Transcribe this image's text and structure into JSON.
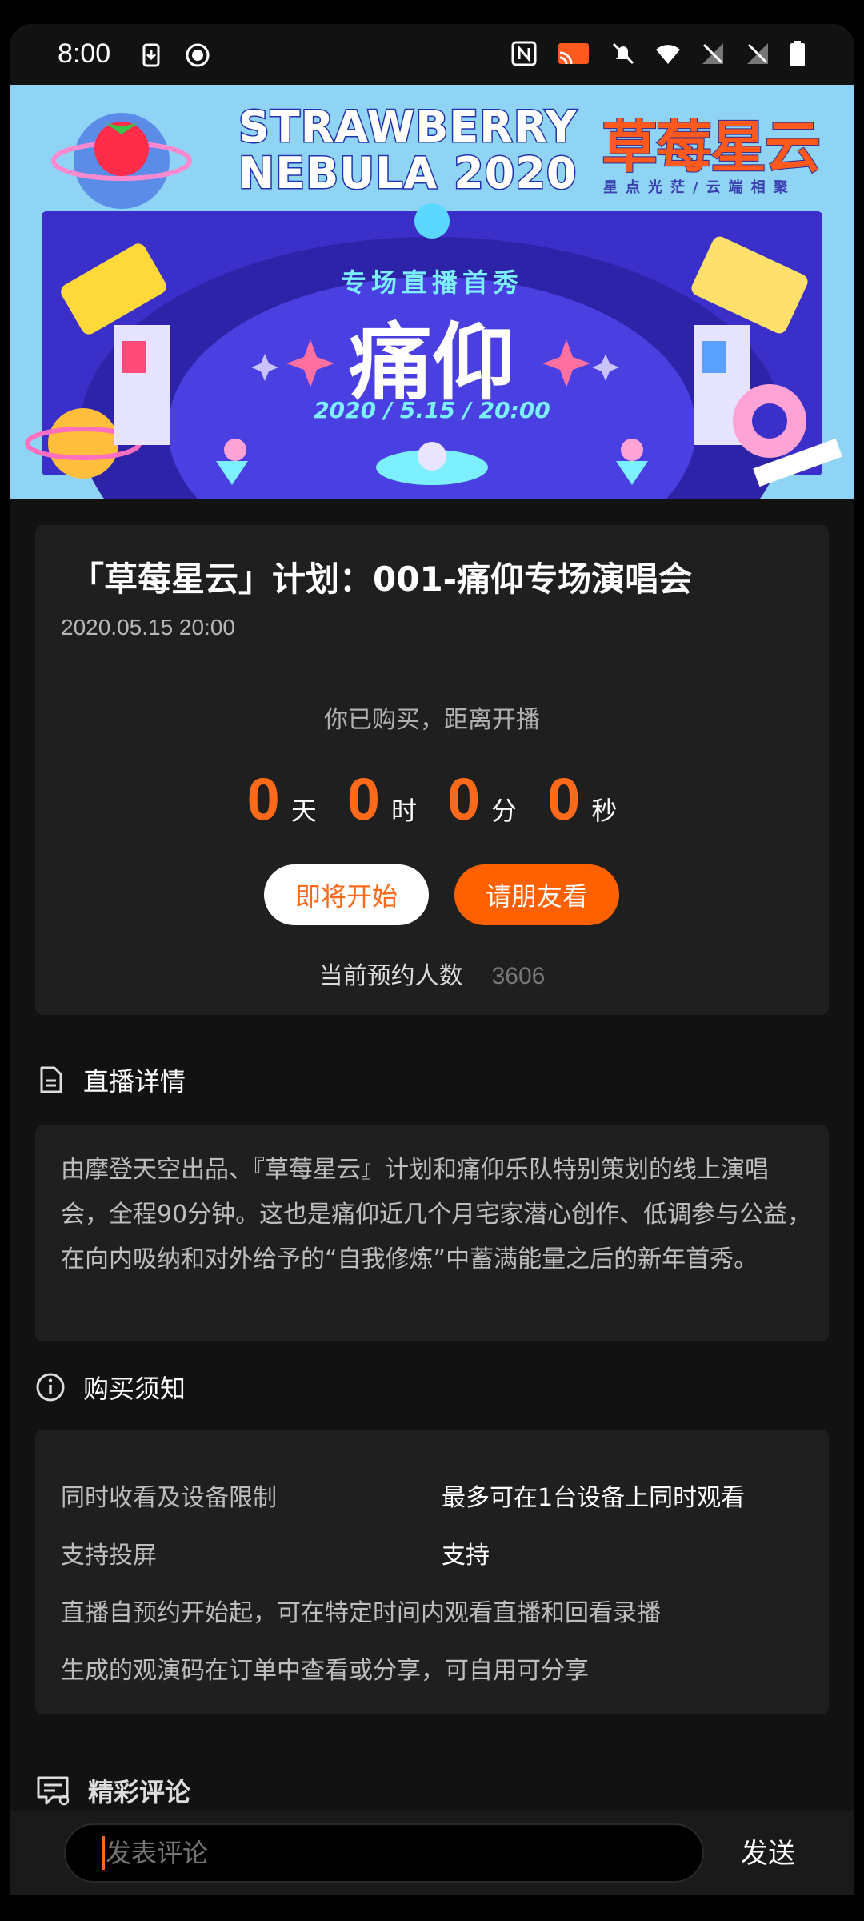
{
  "status_bar": {
    "time": "8:00",
    "left_icons": [
      "sim-download-icon",
      "record-icon"
    ],
    "right_icons": [
      "nfc-icon",
      "cast-icon",
      "mute-bell-icon",
      "wifi-icon",
      "no-signal-icon",
      "no-signal-icon",
      "battery-icon"
    ]
  },
  "banner": {
    "title_line1": "STRAWBERRY",
    "title_line2": "NEBULA",
    "year": "2020",
    "title_cn": "草莓星云",
    "slogan_cn": "星点光茫/云端相聚",
    "subtitle": "专场直播首秀",
    "artist": "痛仰",
    "date": "2020 / 5.15 / 20:00"
  },
  "event": {
    "title": "「草莓星云」计划：001-痛仰专场演唱会",
    "datetime": "2020.05.15 20:00",
    "status": "你已购买，距离开播",
    "countdown": [
      {
        "value": "0",
        "unit": "天"
      },
      {
        "value": "0",
        "unit": "时"
      },
      {
        "value": "0",
        "unit": "分"
      },
      {
        "value": "0",
        "unit": "秒"
      }
    ],
    "start_button": "即将开始",
    "friend_button": "请朋友看",
    "reserve_label": "当前预约人数",
    "reserve_count": "3606"
  },
  "detail": {
    "heading": "直播详情",
    "text": "由摩登天空出品、『草莓星云』计划和痛仰乐队特别策划的线上演唱会，全程90分钟。这也是痛仰近几个月宅家潜心创作、低调参与公益，在向内吸纳和对外给予的“自我修炼”中蓄满能量之后的新年首秀。"
  },
  "purchase": {
    "heading": "购买须知",
    "rows": [
      {
        "label": "同时收看及设备限制",
        "value": "最多可在1台设备上同时观看"
      },
      {
        "label": "支持投屏",
        "value": "支持"
      },
      {
        "label": "直播自预约开始起，可在特定时间内观看直播和回看录播",
        "value": ""
      },
      {
        "label": "生成的观演码在订单中查看或分享，可自用可分享",
        "value": ""
      }
    ]
  },
  "comments": {
    "heading": "精彩评论",
    "input_placeholder": "发表评论",
    "send_label": "发送"
  },
  "colors": {
    "accent": "#ff6000",
    "background": "#121212",
    "card": "#1f1f1f"
  }
}
